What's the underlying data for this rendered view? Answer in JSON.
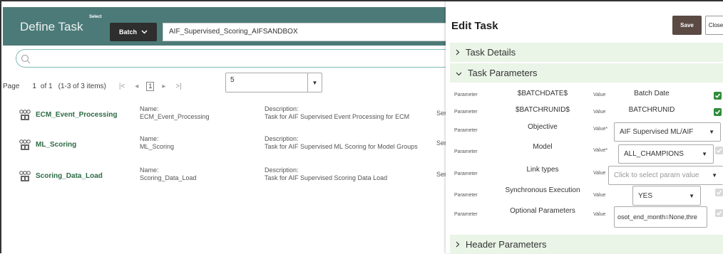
{
  "header": {
    "title": "Define Task",
    "select_label": "Select",
    "batch_button": "Batch",
    "batch_name": "AIF_Supervised_Scoring_AIFSANDBOX"
  },
  "pagination": {
    "page_label": "Page",
    "current_page": "1",
    "of_pages": "of 1",
    "items_range": "(1-3 of 3 items)",
    "page_box": "1",
    "page_size": "5"
  },
  "tasks": [
    {
      "name": "ECM_Event_Processing",
      "name_label": "Name:",
      "name_value": "ECM_Event_Processing",
      "desc_label": "Description:",
      "desc_value": "Task for AIF Supervised Event Processing for ECM",
      "extra": "Serv"
    },
    {
      "name": "ML_Scoring",
      "name_label": "Name:",
      "name_value": "ML_Scoring",
      "desc_label": "Description:",
      "desc_value": "Task for AIF Supervised ML Scoring for Model Groups",
      "extra": "Serv"
    },
    {
      "name": "Scoring_Data_Load",
      "name_label": "Name:",
      "name_value": "Scoring_Data_Load",
      "desc_label": "Description:",
      "desc_value": "Task for AIF Supervised Scoring Data Load",
      "extra": "Serv"
    }
  ],
  "edit_panel": {
    "title": "Edit Task",
    "save_label": "Save",
    "close_label": "Close",
    "sections": {
      "task_details": "Task Details",
      "task_parameters": "Task Parameters",
      "header_parameters": "Header Parameters"
    },
    "param_label": "Parameter",
    "value_label": "Value",
    "value_label_req": "Value*",
    "params": [
      {
        "name": "$BATCHDATE$",
        "value": "Batch Date",
        "checked": true
      },
      {
        "name": "$BATCHRUNID$",
        "value": "BATCHRUNID",
        "checked": true
      },
      {
        "name": "Objective",
        "value": "AIF Supervised ML/AIF",
        "required": true
      },
      {
        "name": "Model",
        "value": "ALL_CHAMPIONS",
        "required": true,
        "checked": false
      },
      {
        "name": "Link types",
        "placeholder": "Click to select param value"
      },
      {
        "name": "Synchronous Execution",
        "value": "YES",
        "checked": false
      },
      {
        "name": "Optional Parameters",
        "value": "osot_end_month=None,thre",
        "checked": false
      }
    ]
  },
  "colors": {
    "header_bg": "#4c7a78",
    "link_green": "#2c6b45",
    "section_bg": "#eaf4e7",
    "check_green": "#2f8b3a",
    "save_bg": "#5a4a43"
  }
}
